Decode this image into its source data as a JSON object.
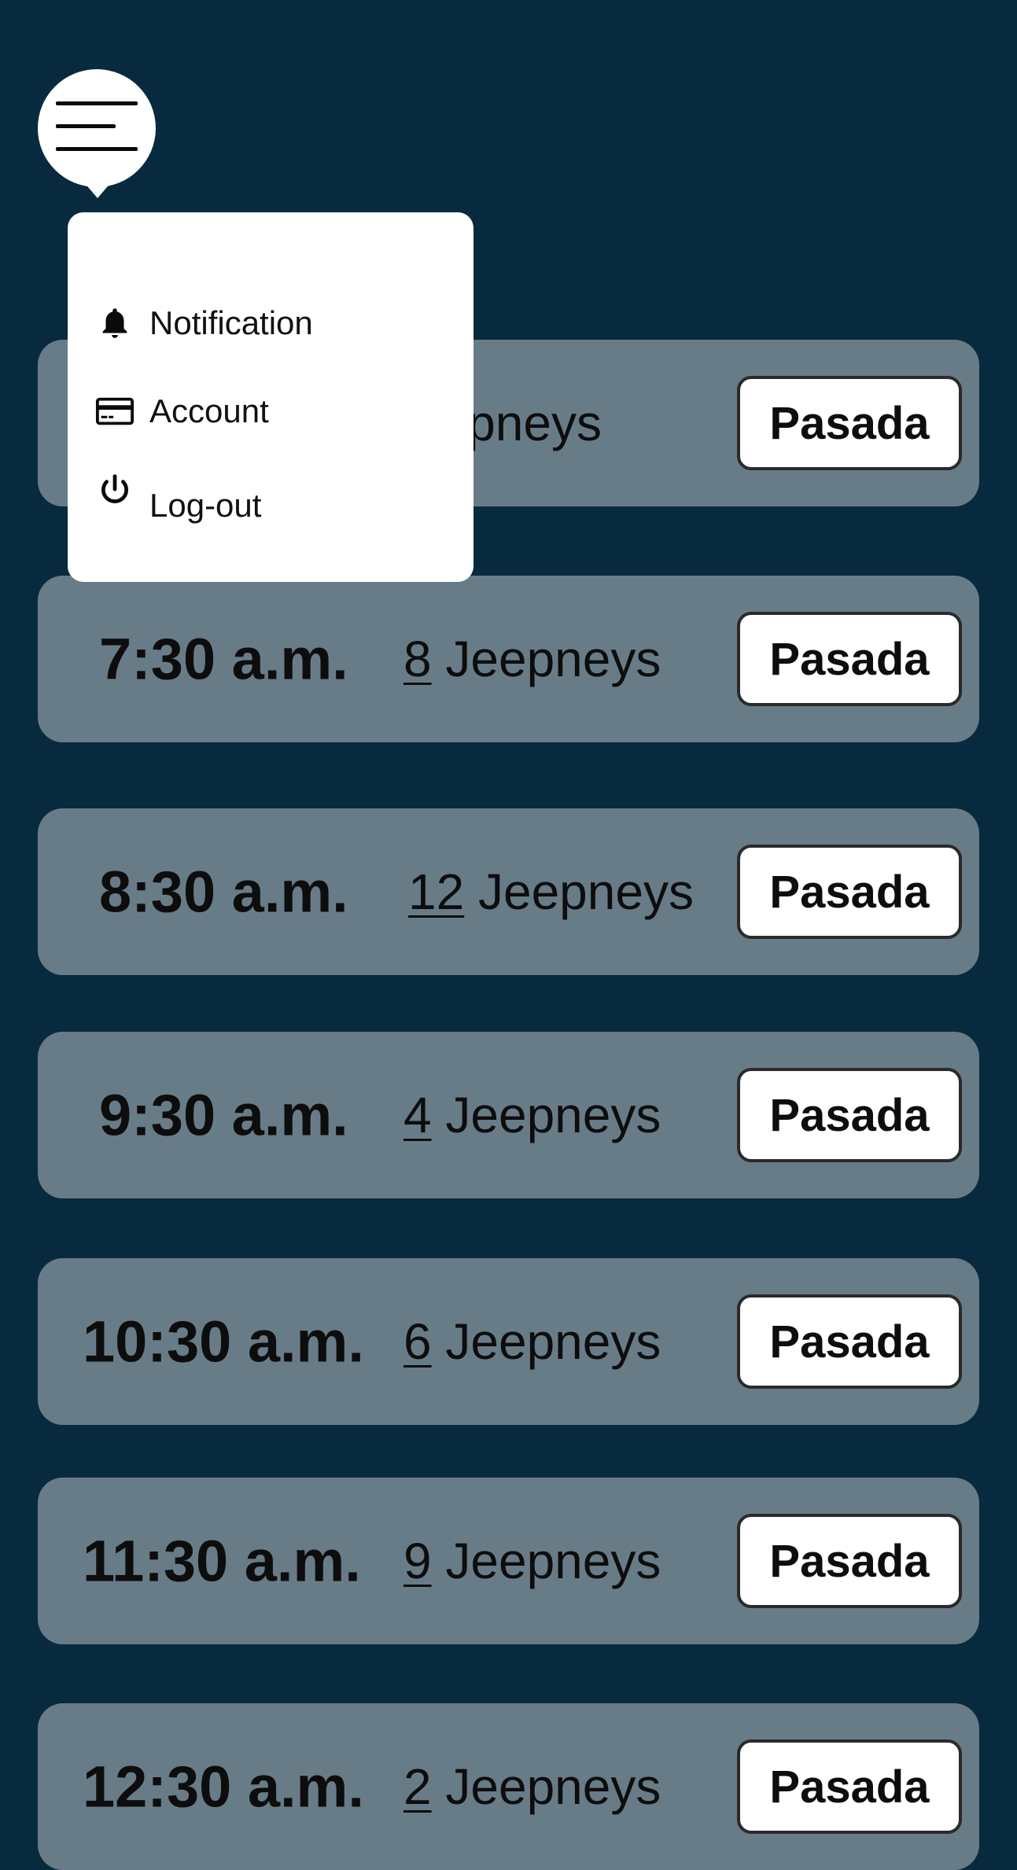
{
  "menu": {
    "items": [
      {
        "label": "Notification",
        "icon": "bell-icon"
      },
      {
        "label": "Account",
        "icon": "credit-card-icon"
      },
      {
        "label": "Log-out",
        "icon": "power-icon"
      }
    ]
  },
  "schedule": [
    {
      "time": "",
      "count": "",
      "unit": "Jeepneys",
      "button": "Pasada"
    },
    {
      "time": "7:30 a.m.",
      "count": "8",
      "unit": "Jeepneys",
      "button": "Pasada"
    },
    {
      "time": "8:30 a.m.",
      "count": "12",
      "unit": "Jeepneys",
      "button": "Pasada"
    },
    {
      "time": "9:30 a.m.",
      "count": "4",
      "unit": "Jeepneys",
      "button": "Pasada"
    },
    {
      "time": "10:30 a.m.",
      "count": "6",
      "unit": "Jeepneys",
      "button": "Pasada"
    },
    {
      "time": "11:30 a.m.",
      "count": "9",
      "unit": "Jeepneys",
      "button": "Pasada"
    },
    {
      "time": "12:30 a.m.",
      "count": "2",
      "unit": "Jeepneys",
      "button": "Pasada"
    }
  ],
  "colors": {
    "background": "#082a3e",
    "row": "#687c88",
    "button": "#ffffff"
  }
}
